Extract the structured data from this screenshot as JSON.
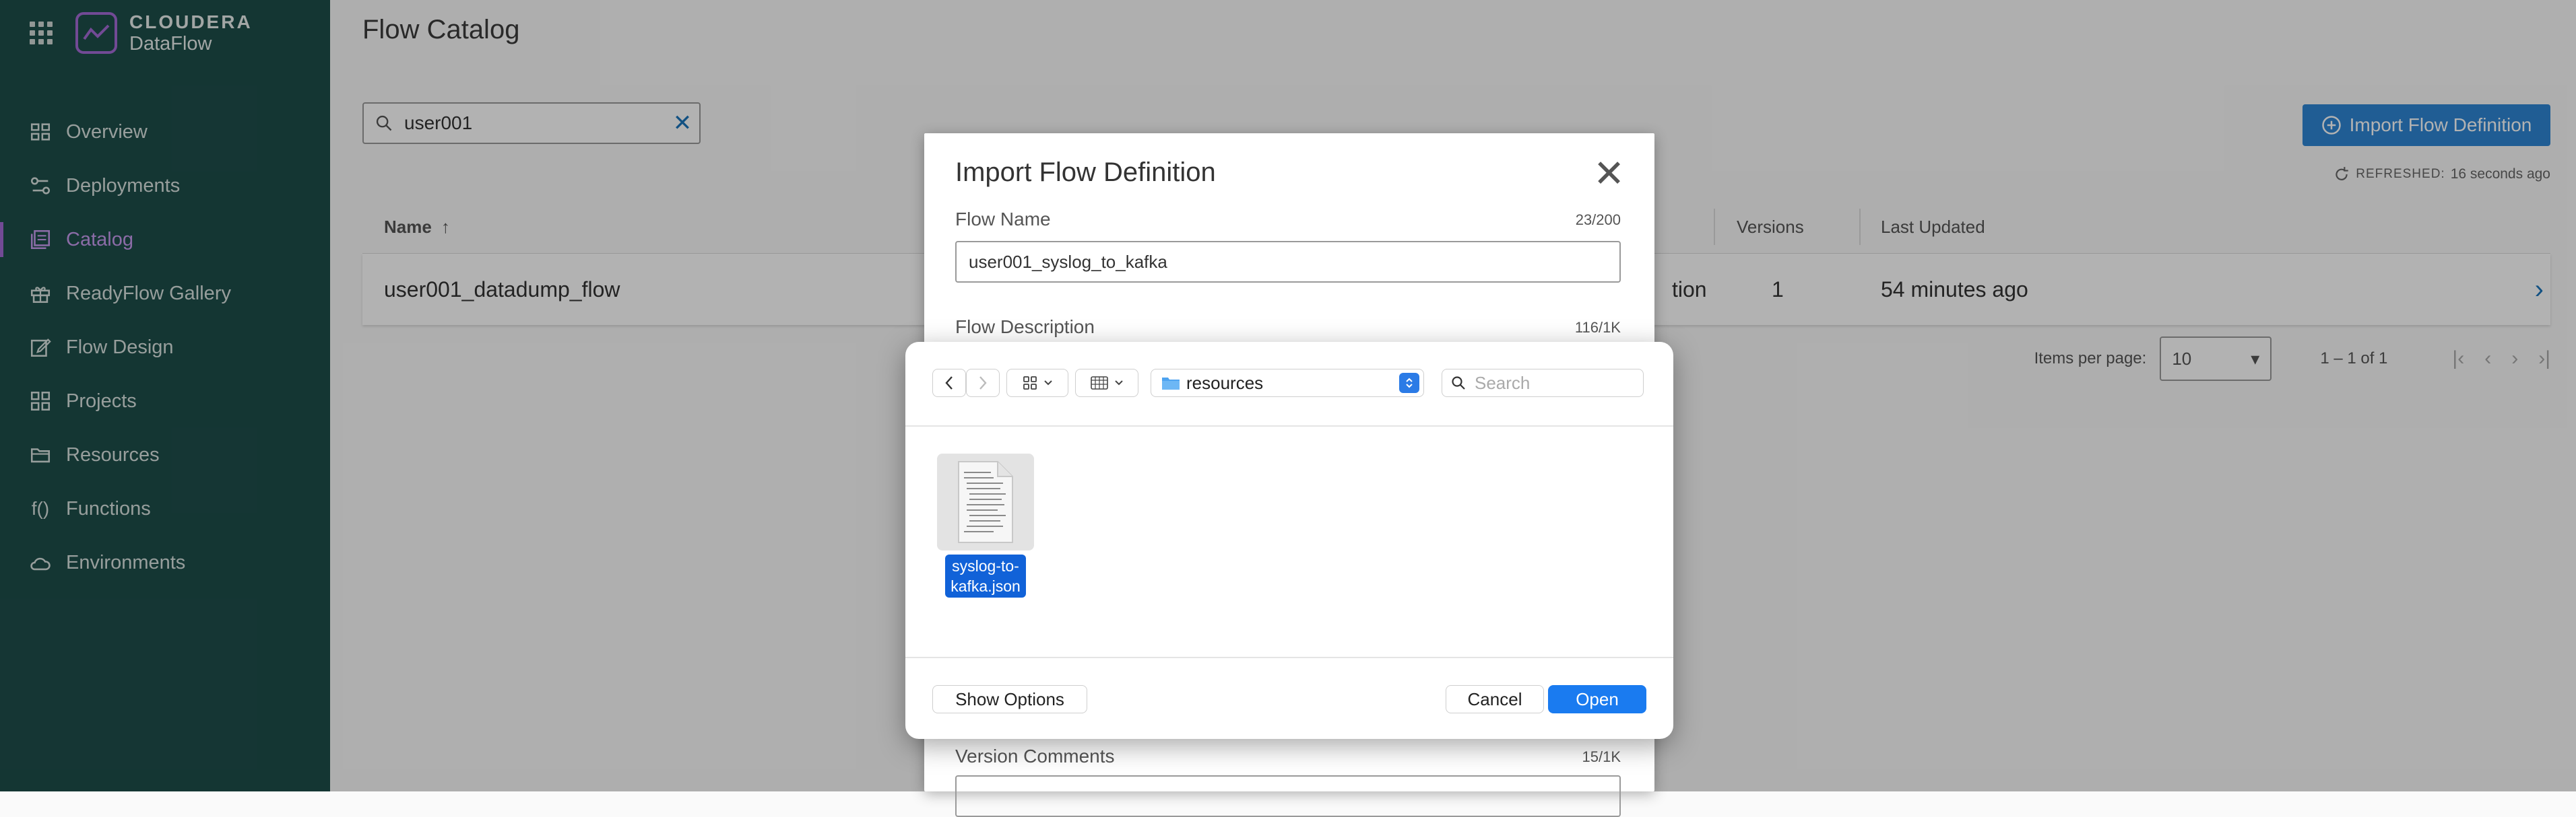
{
  "app": {
    "brand_top": "CLOUDERA",
    "brand_bottom": "DataFlow"
  },
  "sidebar": {
    "items": [
      {
        "label": "Overview",
        "icon": "overview-icon"
      },
      {
        "label": "Deployments",
        "icon": "deployments-icon"
      },
      {
        "label": "Catalog",
        "icon": "catalog-icon",
        "active": true
      },
      {
        "label": "ReadyFlow Gallery",
        "icon": "gift-icon"
      },
      {
        "label": "Flow Design",
        "icon": "edit-icon"
      },
      {
        "label": "Projects",
        "icon": "projects-icon"
      },
      {
        "label": "Resources",
        "icon": "folder-icon"
      },
      {
        "label": "Functions",
        "icon": "function-icon",
        "glyph": "f()"
      },
      {
        "label": "Environments",
        "icon": "cloud-icon"
      }
    ]
  },
  "main": {
    "title": "Flow Catalog",
    "search_value": "user001",
    "import_button": "Import Flow Definition",
    "refreshed_label": "REFRESHED:",
    "refreshed_value": "16 seconds ago",
    "table": {
      "columns": {
        "name": "Name",
        "versions": "Versions",
        "last_updated": "Last Updated"
      },
      "rows": [
        {
          "name": "user001_datadump_flow",
          "partial": "tion",
          "versions": "1",
          "last_updated": "54 minutes ago"
        }
      ]
    },
    "pager": {
      "items_per_page_label": "Items per page:",
      "items_per_page": "10",
      "range": "1 – 1 of 1"
    }
  },
  "import_modal": {
    "title": "Import Flow Definition",
    "flow_name_label": "Flow Name",
    "flow_name_count": "23/200",
    "flow_name_value": "user001_syslog_to_kafka",
    "description_label": "Flow Description",
    "description_count": "116/1K",
    "comments_label": "Version Comments",
    "comments_count": "15/1K"
  },
  "file_dialog": {
    "location": "resources",
    "search_placeholder": "Search",
    "file": {
      "name_line1": "syslog-to-",
      "name_line2": "kafka.json"
    },
    "show_options": "Show Options",
    "cancel": "Cancel",
    "open": "Open"
  },
  "colors": {
    "sidebar_bg": "#1e4e4a",
    "accent_purple": "#a46bd6",
    "primary_blue": "#2e86d4",
    "mac_blue": "#1a7bf0"
  }
}
